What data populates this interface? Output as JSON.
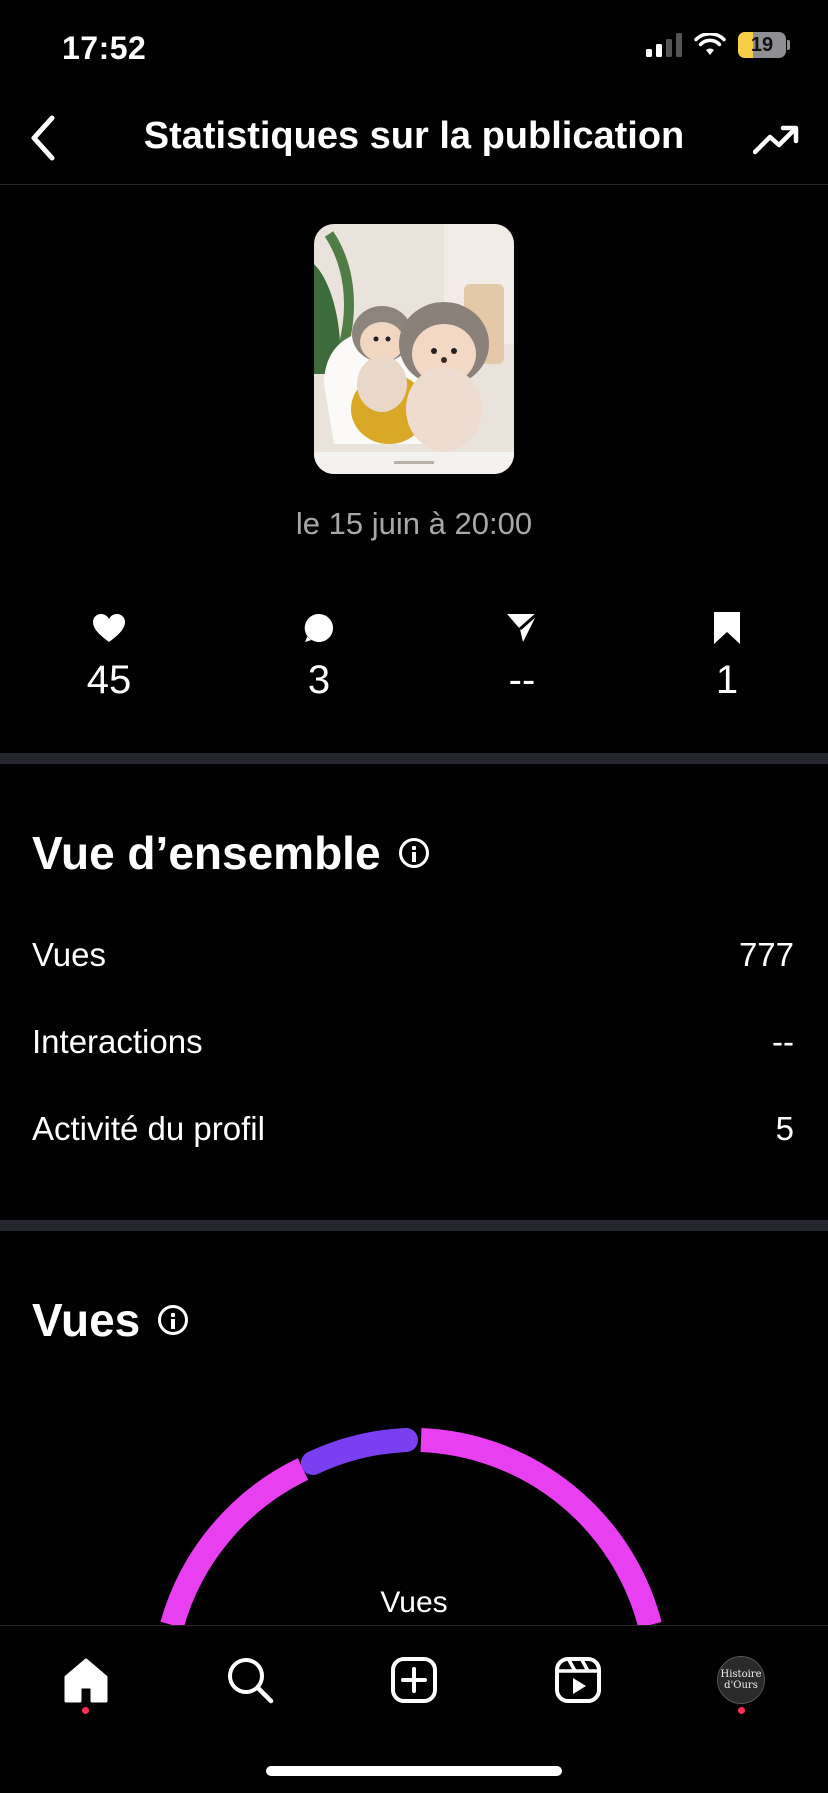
{
  "status_bar": {
    "time": "17:52",
    "battery_level": "19",
    "battery_color": "#f7ce46"
  },
  "header": {
    "title": "Statistiques sur la publication",
    "back_icon": "chevron-left-icon",
    "action_icon": "trending-up-icon"
  },
  "post": {
    "date": "le 15 juin à 20:00"
  },
  "metrics": [
    {
      "icon": "heart-icon",
      "value": "45"
    },
    {
      "icon": "comment-icon",
      "value": "3"
    },
    {
      "icon": "share-icon",
      "value": "--"
    },
    {
      "icon": "bookmark-icon",
      "value": "1"
    }
  ],
  "overview": {
    "title": "Vue d’ensemble",
    "rows": [
      {
        "label": "Vues",
        "value": "777"
      },
      {
        "label": "Interactions",
        "value": "--"
      },
      {
        "label": "Activité du profil",
        "value": "5"
      }
    ]
  },
  "views": {
    "title": "Vues",
    "donut_label": "Vues",
    "colors": {
      "primary": "#e83ff0",
      "secondary": "#7b3ff2"
    }
  },
  "profile": {
    "avatar_line1": "Histoire",
    "avatar_line2": "d'Ours"
  },
  "tabs": [
    "home-icon",
    "search-icon",
    "create-icon",
    "reels-icon",
    "profile-avatar"
  ]
}
